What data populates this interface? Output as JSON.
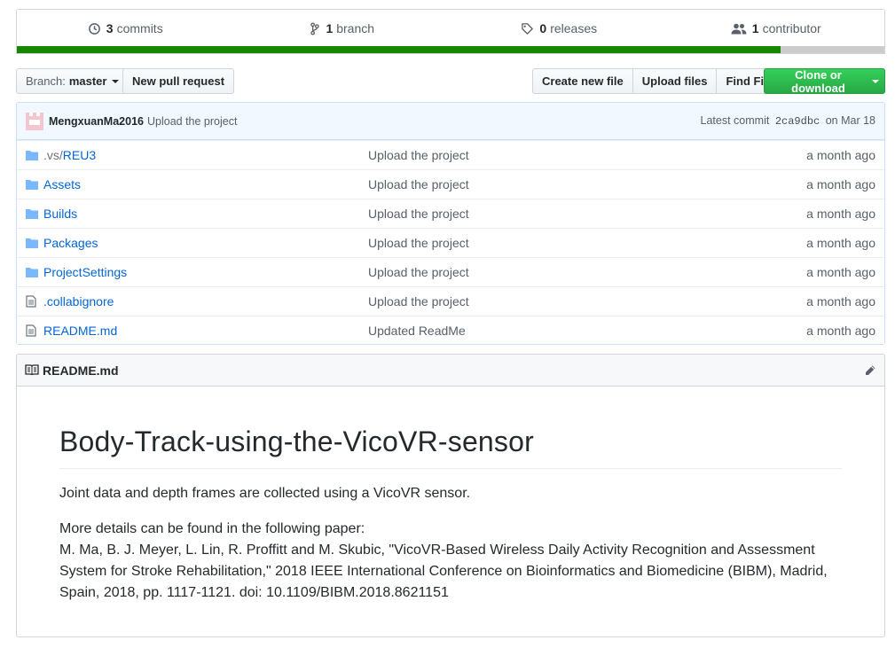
{
  "summary": {
    "commits": {
      "count": "3",
      "label": "commits"
    },
    "branches": {
      "count": "1",
      "label": "branch"
    },
    "releases": {
      "count": "0",
      "label": "releases"
    },
    "contributors": {
      "count": "1",
      "label": "contributor"
    },
    "language_bar": {
      "primary_color": "#178600",
      "secondary_color": "#cccccc",
      "primary_fraction": 0.88
    }
  },
  "toolbar": {
    "branch_prefix": "Branch:",
    "branch_name": "master",
    "new_pull_request": "New pull request",
    "create_new_file": "Create new file",
    "upload_files": "Upload files",
    "find_file": "Find File",
    "clone_or_download": "Clone or download",
    "clone_color": "#28a745"
  },
  "commit_tease": {
    "author": "MengxuanMa2016",
    "message": "Upload the project",
    "latest_label": "Latest commit",
    "sha": "2ca9dbc",
    "date": "on Mar 18"
  },
  "files": [
    {
      "dir_prefix": ".vs/",
      "name": "REU3",
      "type": "folder",
      "message": "Upload the project",
      "age": "a month ago"
    },
    {
      "dir_prefix": "",
      "name": "Assets",
      "type": "folder",
      "message": "Upload the project",
      "age": "a month ago"
    },
    {
      "dir_prefix": "",
      "name": "Builds",
      "type": "folder",
      "message": "Upload the project",
      "age": "a month ago"
    },
    {
      "dir_prefix": "",
      "name": "Packages",
      "type": "folder",
      "message": "Upload the project",
      "age": "a month ago"
    },
    {
      "dir_prefix": "",
      "name": "ProjectSettings",
      "type": "folder",
      "message": "Upload the project",
      "age": "a month ago"
    },
    {
      "dir_prefix": "",
      "name": ".collabignore",
      "type": "file",
      "message": "Upload the project",
      "age": "a month ago"
    },
    {
      "dir_prefix": "",
      "name": "README.md",
      "type": "file",
      "message": "Updated ReadMe",
      "age": "a month ago"
    }
  ],
  "readme": {
    "filename": "README.md",
    "title": "Body-Track-using-the-VicoVR-sensor",
    "paragraph1": "Joint data and depth frames are collected using a VicoVR sensor.",
    "paragraph2_line1": "More details can be found in the following paper:",
    "paragraph2_line2": "M. Ma, B. J. Meyer, L. Lin, R. Proffitt and M. Skubic, \"VicoVR-Based Wireless Daily Activity Recognition and Assessment System for Stroke Rehabilitation,\" 2018 IEEE International Conference on Bioinformatics and Biomedicine (BIBM), Madrid, Spain, 2018, pp. 1117-1121. doi: 10.1109/BIBM.2018.8621151"
  }
}
